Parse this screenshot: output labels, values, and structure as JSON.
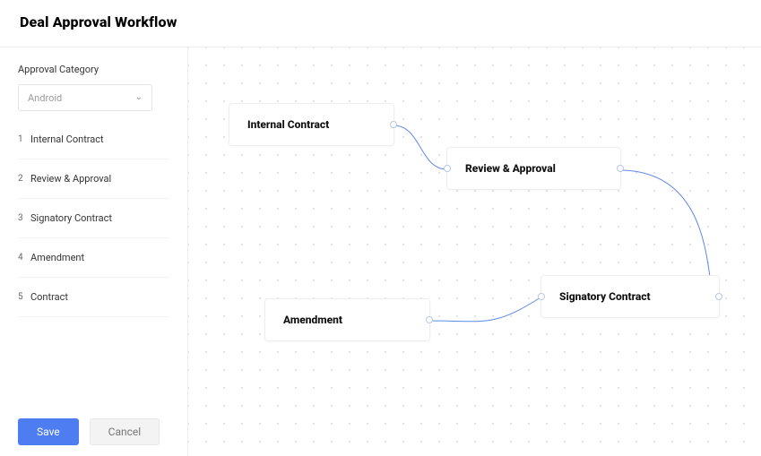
{
  "header": {
    "title": "Deal Approval Workflow"
  },
  "sidebar": {
    "category_label": "Approval Category",
    "selected_category": "Android",
    "steps": [
      {
        "num": "1",
        "label": "Internal Contract"
      },
      {
        "num": "2",
        "label": "Review & Approval"
      },
      {
        "num": "3",
        "label": "Signatory Contract"
      },
      {
        "num": "4",
        "label": "Amendment"
      },
      {
        "num": "5",
        "label": "Contract"
      }
    ],
    "save_label": "Save",
    "cancel_label": "Cancel"
  },
  "canvas": {
    "nodes": {
      "internal_contract": "Internal Contract",
      "review_approval": "Review & Approval",
      "signatory_contract": "Signatory Contract",
      "amendment": "Amendment"
    }
  }
}
